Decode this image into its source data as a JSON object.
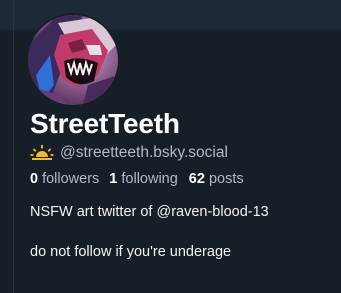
{
  "profile": {
    "display_name": "StreetTeeth",
    "handle": "@streetteeth.bsky.social",
    "handle_icon": "sunrise-emoji-icon",
    "avatar_icon": "avatar-image"
  },
  "stats": {
    "followers_count": "0",
    "followers_label": "followers",
    "following_count": "1",
    "following_label": "following",
    "posts_count": "62",
    "posts_label": "posts"
  },
  "bio": {
    "line1": "NSFW art twitter of @raven-blood-13",
    "line2": "do not follow if you're underage"
  },
  "colors": {
    "background": "#161e27",
    "text_primary": "#ffffff",
    "text_secondary": "#aebbc9"
  }
}
